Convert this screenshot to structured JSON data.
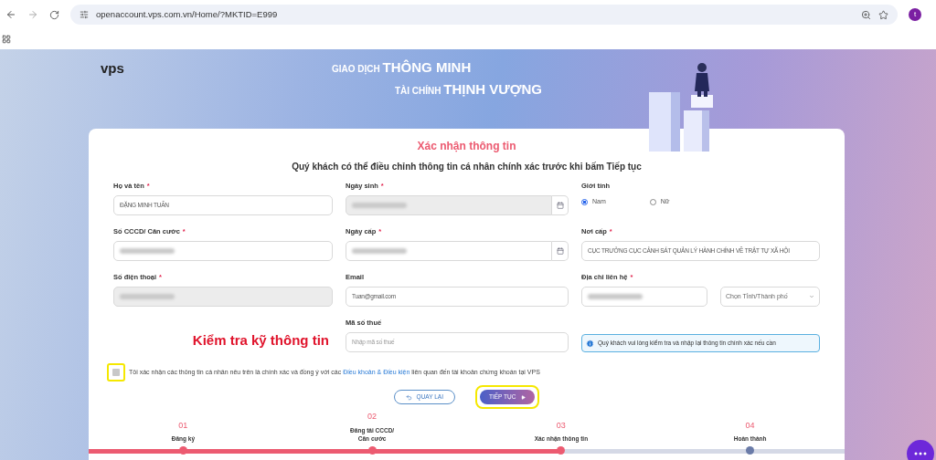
{
  "browser": {
    "url": "openaccount.vps.com.vn/Home/?MKTID=E999",
    "profile_initial": "t"
  },
  "banner": {
    "logo": "vps",
    "line_1_small": "GIAO DỊCH",
    "line_1_big": "THÔNG MINH",
    "line_2_small": "TÀI CHÍNH",
    "line_2_big": "THỊNH VƯỢNG"
  },
  "form": {
    "title": "Xác nhận thông tin",
    "subtitle": "Quý khách có thể điều chỉnh thông tin cá nhân chính xác trước khi bấm Tiếp tục",
    "rows": [
      [
        {
          "kind": "text",
          "label": "Họ và tên",
          "required_mark": "*",
          "value": "ĐẶNG MINH TUẤN",
          "redacted": false,
          "disabled": false
        },
        {
          "kind": "date",
          "label": "Ngày sinh",
          "required_mark": "*",
          "redacted": true,
          "disabled": true
        },
        {
          "kind": "radio",
          "label": "Giới tính",
          "options": [
            {
              "label": "Nam",
              "selected": true
            },
            {
              "label": "Nữ",
              "selected": false
            }
          ]
        }
      ],
      [
        {
          "kind": "text",
          "label": "Số CCCD/ Căn cước",
          "required_mark": "*",
          "redacted": true,
          "disabled": false
        },
        {
          "kind": "date",
          "label": "Ngày cấp",
          "required_mark": "*",
          "redacted": true,
          "disabled": false
        },
        {
          "kind": "text",
          "label": "Nơi cấp",
          "required_mark": "*",
          "value": "CỤC TRƯỞNG CỤC CẢNH SÁT QUẢN LÝ HÀNH CHÍNH VỀ TRẬT TỰ XÃ HỘI",
          "redacted": false,
          "disabled": false
        }
      ],
      [
        {
          "kind": "text",
          "label": "Số điện thoại",
          "required_mark": "*",
          "redacted": true,
          "disabled": true
        },
        {
          "kind": "text",
          "label": "Email",
          "value": "Tuan@gmail.com",
          "redacted": false,
          "disabled": false
        },
        {
          "kind": "address",
          "label": "Địa chỉ liên hệ",
          "required_mark": "*",
          "redacted": true,
          "select_placeholder": "Chọn Tỉnh/Thành phố"
        }
      ],
      [
        {
          "kind": "annotation",
          "text": "Kiểm tra kỹ thông tin"
        },
        {
          "kind": "text",
          "label": "Mã số thuế",
          "placeholder": "Nhập mã số thuế",
          "redacted": false,
          "disabled": false
        },
        {
          "kind": "note",
          "text": "Quý khách vui lòng kiểm tra và nhập lại thông tin chính xác nếu cần"
        }
      ]
    ],
    "consent": {
      "checked": false,
      "highlighted": true,
      "text_before": "Tôi xác nhận các thông tin cá nhân nêu trên là chính xác và đồng ý với các",
      "link": "Điều khoản & Điều kiện",
      "text_after": "liên quan đến tài khoản chứng khoán tại VPS"
    },
    "back_button": {
      "label": "QUAY LẠI"
    },
    "next_button": {
      "label": "TIẾP TỤC",
      "highlighted": true
    }
  },
  "steps": [
    {
      "number": "01",
      "label": "Đăng ký",
      "completed": true
    },
    {
      "number": "02",
      "label": "Đăng tải CCCD/ Căn cước",
      "completed": true
    },
    {
      "number": "03",
      "label": "Xác nhận thông tin",
      "completed": true
    },
    {
      "number": "04",
      "label": "Hoàn thành",
      "completed": false
    }
  ]
}
